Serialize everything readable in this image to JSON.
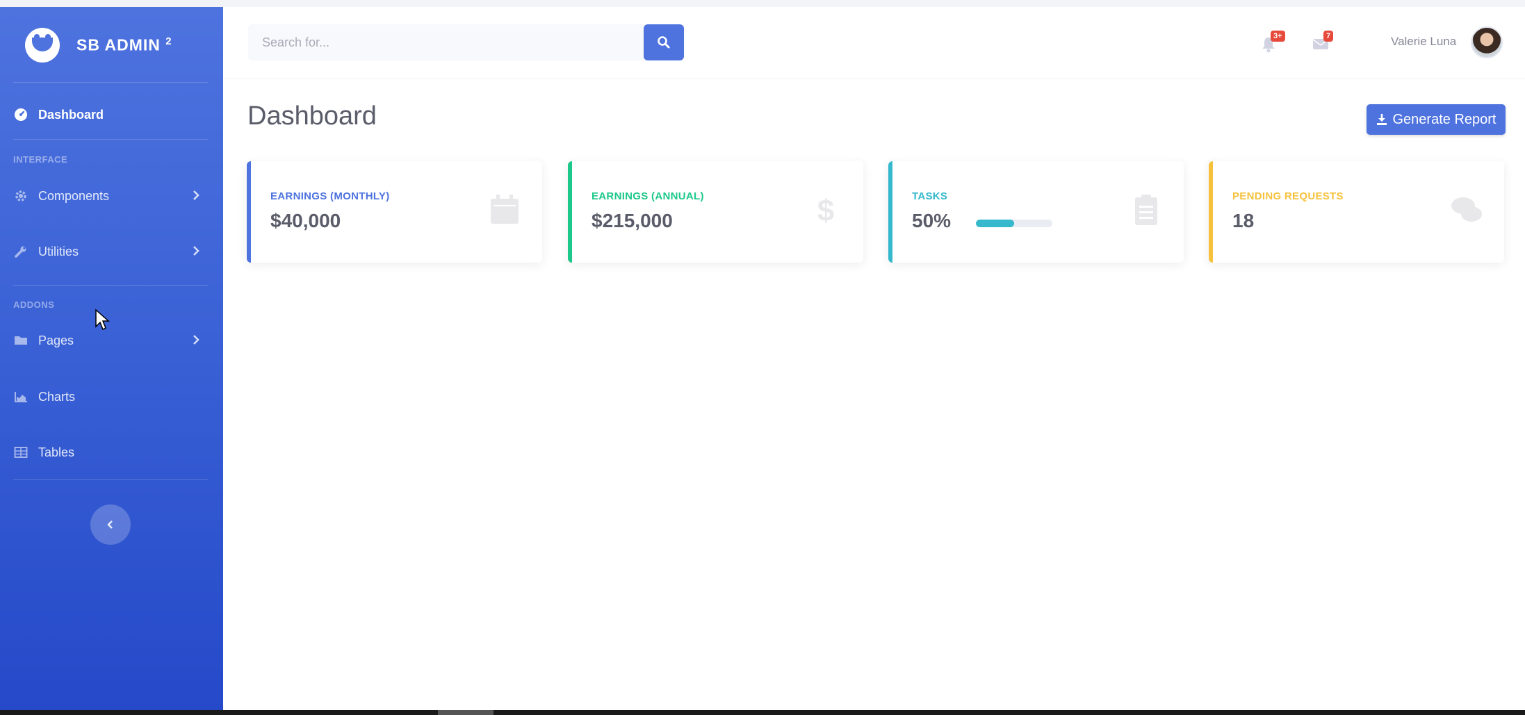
{
  "brand": {
    "name": "SB ADMIN",
    "superscript": "2"
  },
  "sidebar": {
    "dashboard": {
      "label": "Dashboard",
      "icon": "tachometer-icon"
    },
    "heading_interface": "INTERFACE",
    "components": {
      "label": "Components",
      "icon": "cog-icon"
    },
    "utilities": {
      "label": "Utilities",
      "icon": "wrench-icon"
    },
    "heading_addons": "ADDONS",
    "pages": {
      "label": "Pages",
      "icon": "folder-icon"
    },
    "charts": {
      "label": "Charts",
      "icon": "chart-area-icon"
    },
    "tables": {
      "label": "Tables",
      "icon": "table-icon"
    },
    "toggle_icon": "chevron-left-icon"
  },
  "topbar": {
    "search_placeholder": "Search for...",
    "alerts_badge": "3+",
    "messages_badge": "7",
    "user_name": "Valerie Luna"
  },
  "main": {
    "title": "Dashboard",
    "report_button": "Generate Report"
  },
  "cards": [
    {
      "label": "Earnings (Monthly)",
      "value": "$40,000",
      "color": "#4e73df",
      "icon": "calendar-icon"
    },
    {
      "label": "Earnings (Annual)",
      "value": "$215,000",
      "color": "#1cc88a",
      "icon": "dollar-icon"
    },
    {
      "label": "Tasks",
      "value": "50%",
      "color": "#36b9cc",
      "icon": "clipboard-list-icon",
      "progress": 0.5
    },
    {
      "label": "Pending Requests",
      "value": "18",
      "color": "#f6c23e",
      "icon": "comments-icon"
    }
  ],
  "colors": {
    "primary": "#4e73df",
    "success": "#1cc88a",
    "info": "#36b9cc",
    "warning": "#f6c23e",
    "danger": "#e74a3b"
  }
}
